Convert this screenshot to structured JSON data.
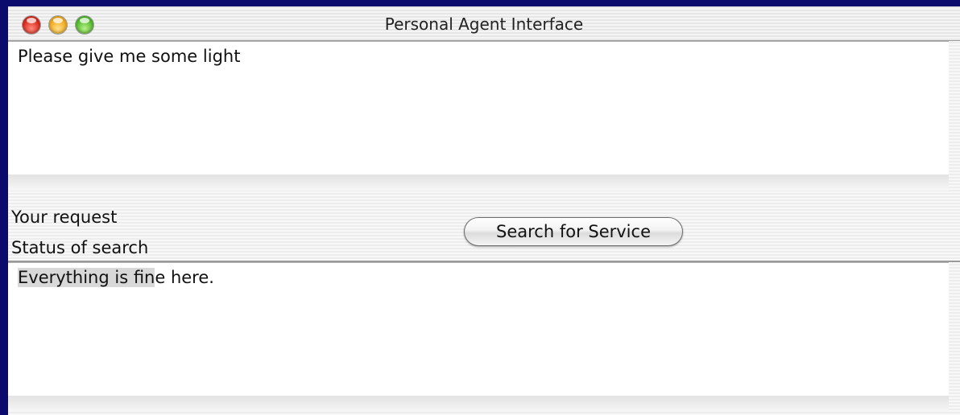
{
  "window": {
    "title": "Personal Agent Interface"
  },
  "request": {
    "text": "Please give me some light",
    "label": "Your request"
  },
  "status": {
    "label": "Status of search",
    "text_selected": "Everything is fin",
    "text_rest": "e here."
  },
  "actions": {
    "search_label": "Search for Service"
  }
}
